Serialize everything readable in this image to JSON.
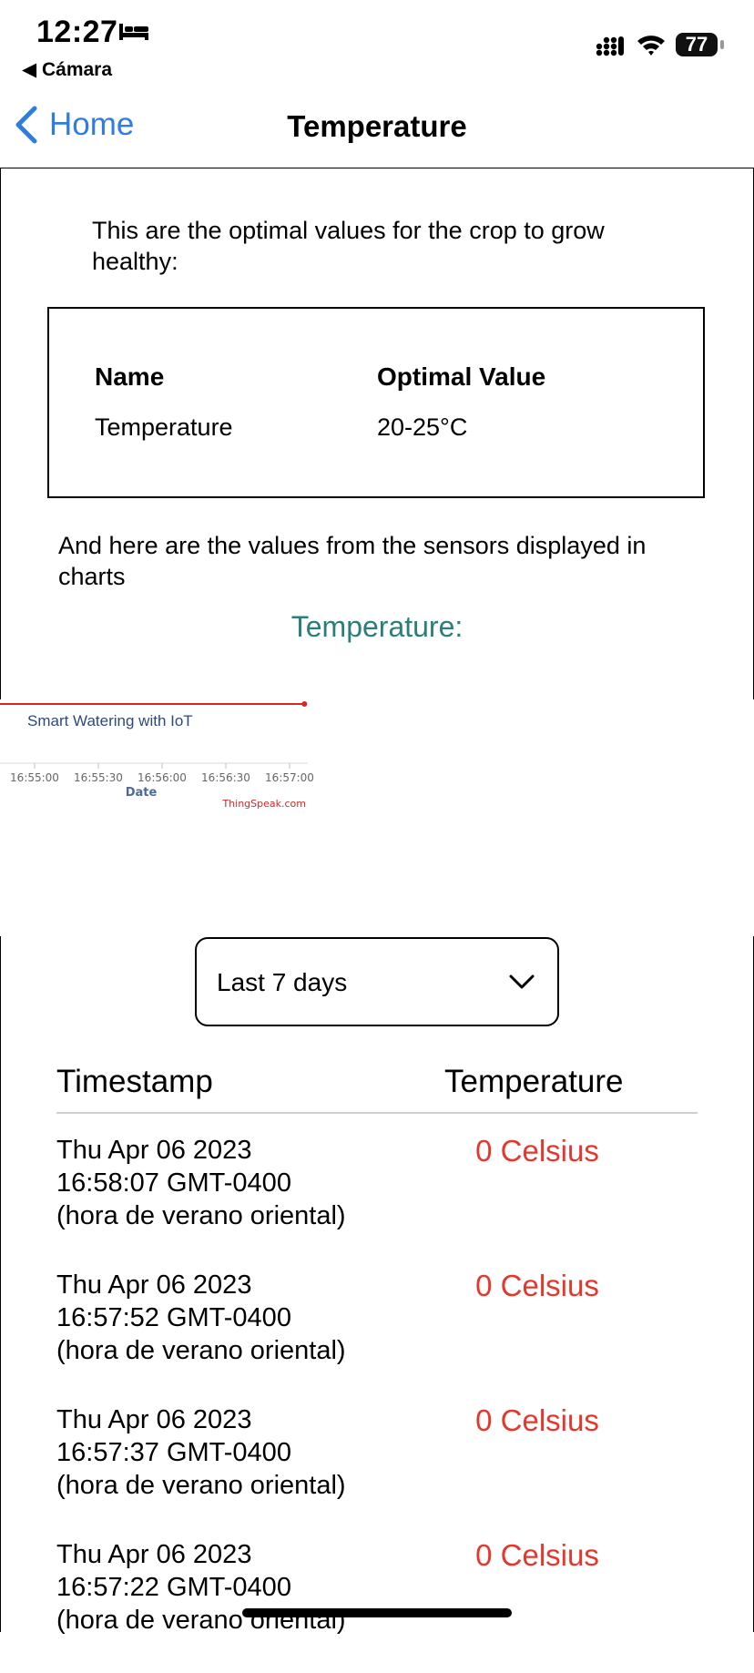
{
  "status_bar": {
    "time": "12:27",
    "back_app": "◀ Cámara",
    "battery": "77"
  },
  "nav": {
    "back_label": "Home",
    "title": "Temperature",
    "accent_color": "#2f7de1"
  },
  "intro": {
    "text": "This are the optimal values for the crop to grow healthy:"
  },
  "optimal_table": {
    "header_name": "Name",
    "header_value": "Optimal Value",
    "rows": [
      {
        "name": "Temperature",
        "value": "20-25°C"
      }
    ]
  },
  "sensor_text": "And here are the values from the sensors displayed in charts",
  "section_title": "Temperature:",
  "chart_data": {
    "type": "line",
    "title": "Smart Watering with IoT",
    "xlabel": "Date",
    "ylabel": "",
    "x_ticks": [
      "16:55:00",
      "16:55:30",
      "16:56:00",
      "16:56:30",
      "16:57:00"
    ],
    "series": [
      {
        "color": "#d62728",
        "points": [
          {
            "x": "16:54:30",
            "y": 0
          },
          {
            "x": "16:57:07",
            "y": 0
          }
        ]
      }
    ],
    "credit": "ThingSpeak.com"
  },
  "dropdown": {
    "selected": "Last 7 days"
  },
  "readings_table": {
    "header_timestamp": "Timestamp",
    "header_temperature": "Temperature",
    "value_color": "#e5372c",
    "rows": [
      {
        "timestamp": "Thu Apr 06 2023\n16:58:07 GMT-0400\n(hora de verano oriental)",
        "value": "0 Celsius"
      },
      {
        "timestamp": "Thu Apr 06 2023\n16:57:52 GMT-0400\n(hora de verano oriental)",
        "value": "0 Celsius"
      },
      {
        "timestamp": "Thu Apr 06 2023\n16:57:37 GMT-0400\n(hora de verano oriental)",
        "value": "0 Celsius"
      },
      {
        "timestamp": "Thu Apr 06 2023\n16:57:22 GMT-0400\n(hora de verano oriental)",
        "value": "0 Celsius"
      }
    ]
  }
}
